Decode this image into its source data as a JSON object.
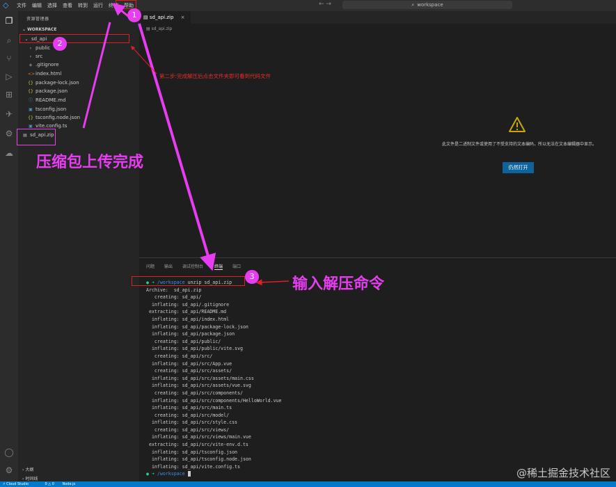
{
  "titlebar": {
    "menu": [
      "文件",
      "编辑",
      "选择",
      "查看",
      "转到",
      "运行",
      "终端",
      "帮助"
    ],
    "search": "workspace"
  },
  "sidebar": {
    "title": "资源管理器",
    "workspace": "WORKSPACE",
    "folder": "sd_api",
    "items": [
      {
        "label": "public",
        "icon": "chevron-right-icon"
      },
      {
        "label": "src",
        "icon": "chevron-right-icon"
      },
      {
        "label": ".gitignore",
        "icon": "git-icon"
      },
      {
        "label": "index.html",
        "icon": "html-icon"
      },
      {
        "label": "package-lock.json",
        "icon": "json-icon"
      },
      {
        "label": "package.json",
        "icon": "json-icon"
      },
      {
        "label": "README.md",
        "icon": "info-icon"
      },
      {
        "label": "tsconfig.json",
        "icon": "ts-icon"
      },
      {
        "label": "tsconfig.node.json",
        "icon": "json-icon"
      },
      {
        "label": "vite.config.ts",
        "icon": "ts-icon"
      }
    ],
    "zip_file": "sd_api.zip",
    "outline": "大纲",
    "timeline": "时间线"
  },
  "editor": {
    "tab": "sd_api.zip",
    "breadcrumb": "sd_api.zip",
    "binary_message": "此文件是二进制文件或使用了不受支持的文本编码，所以无法在文本编辑器中显示。",
    "open_button": "仍然打开"
  },
  "panel": {
    "tabs": [
      "问题",
      "输出",
      "调试控制台",
      "终端",
      "端口"
    ],
    "prompt_dir": "/workspace",
    "command": "unzip sd_api.zip",
    "lines": [
      "Archive:  sd_api.zip",
      "   creating: sd_api/",
      "  inflating: sd_api/.gitignore",
      " extracting: sd_api/README.md",
      "  inflating: sd_api/index.html",
      "  inflating: sd_api/package-lock.json",
      "  inflating: sd_api/package.json",
      "   creating: sd_api/public/",
      "  inflating: sd_api/public/vite.svg",
      "   creating: sd_api/src/",
      "  inflating: sd_api/src/App.vue",
      "   creating: sd_api/src/assets/",
      "  inflating: sd_api/src/assets/main.css",
      "  inflating: sd_api/src/assets/vue.svg",
      "   creating: sd_api/src/components/",
      "  inflating: sd_api/src/components/HelloWorld.vue",
      "  inflating: sd_api/src/main.ts",
      "   creating: sd_api/src/model/",
      "  inflating: sd_api/src/style.css",
      "   creating: sd_api/src/views/",
      "  inflating: sd_api/src/views/main.vue",
      " extracting: sd_api/src/vite-env.d.ts",
      "  inflating: sd_api/tsconfig.json",
      "  inflating: sd_api/tsconfig.node.json",
      "  inflating: sd_api/vite.config.ts"
    ]
  },
  "status": {
    "remote": "Cloud Studio",
    "problems": "0 △ 0",
    "lang": "Node.js"
  },
  "annotations": {
    "step1": "1",
    "step2": "2",
    "step3": "3",
    "upload_done": "压缩包上传完成",
    "step2_note": "第二步:完成解压后点击文件夹即可看到代码文件",
    "unzip_cmd": "输入解压命令"
  },
  "watermark": "@稀土掘金技术社区",
  "colors": {
    "annotation_magenta": "#e63df0",
    "annotation_red": "#e01e26",
    "accent_blue": "#007acc"
  }
}
